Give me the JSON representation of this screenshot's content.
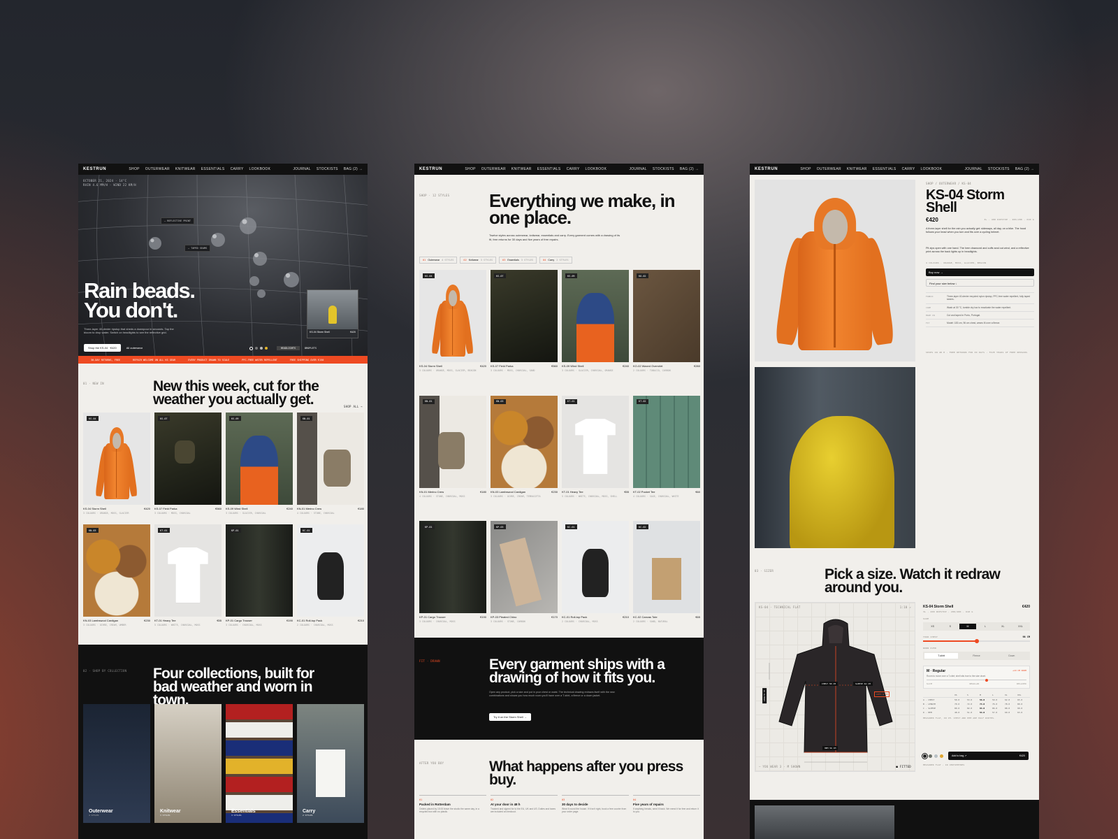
{
  "brand": "KESTRUN",
  "nav": {
    "links": [
      "SHOP",
      "OUTERWEAR",
      "KNITWEAR",
      "ESSENTIALS",
      "CARRY",
      "LOOKBOOK"
    ],
    "right": [
      "JOURNAL",
      "STOCKISTS",
      "BAG (2) →"
    ]
  },
  "home": {
    "meta": "OCTOBER 21, 2024 · 14°C\nRAIN 4.6 MM/H · WIND 22 KM/H",
    "hero_title_1": "Rain beads.",
    "hero_title_2": "You don't.",
    "hero_body": "Three-layer 40-denier ripstop that sheds a downpour in seconds. Tap the bloom to drop water. Switch on headlights to see the reflective grid.",
    "hero_cta": "Shop the KS-04 · €420",
    "hero_link": "All outerwear",
    "callout_1": "— REFLECTIVE PRINT",
    "callout_2": "— TAPED SEAMS",
    "mini_card_name": "KS-04 Storm Shell",
    "mini_card_price": "€420",
    "toggle_a": "HEADLIGHTS",
    "toggle_b": "DROPLETS",
    "ticker": [
      "30-DAY RETURNS, FREE",
      "REPAIR WELCOME ON ALL KS GEAR",
      "EVERY PRODUCT DRAWN TO SCALE",
      "PFC-FREE WATER REPELLENT",
      "FREE SHIPPING OVER €150"
    ],
    "new_kicker": "01 · NEW IN",
    "new_title": "New this week, cut for the weather you actually get.",
    "shop_all": "SHOP ALL →",
    "new_items": [
      {
        "tag": "KS-04",
        "name": "KS-04 Storm Shell",
        "price": "€420",
        "sub": "3 COLOURS · ORANGE, MOSS, GLACIER"
      },
      {
        "tag": "KS-07",
        "name": "KS-07 Field Parka",
        "price": "€560",
        "sub": "3 COLOURS · MOSS, CHARCOAL"
      },
      {
        "tag": "KS-09",
        "name": "KS-09 Wind Shell",
        "price": "€240",
        "sub": "3 COLOURS · GLACIER, CHARCOAL"
      },
      {
        "tag": "KN-01",
        "name": "KN-01 Merino Crew",
        "price": "€180",
        "sub": "4 COLOURS · STONE, CHARCOAL"
      },
      {
        "tag": "KN-03",
        "name": "KN-03 Lambswool Cardigan",
        "price": "€230",
        "sub": "3 COLOURS · OCHRE, CREAM, UMBER"
      },
      {
        "tag": "KT-01",
        "name": "KT-01 Heavy Tee",
        "price": "€55",
        "sub": "5 COLOURS · WHITE, CHARCOAL, MOSS"
      },
      {
        "tag": "KP-01",
        "name": "KP-01 Cargo Trouser",
        "price": "€190",
        "sub": "3 COLOURS · CHARCOAL, MOSS"
      },
      {
        "tag": "KC-01",
        "name": "KC-01 Roll-top Pack",
        "price": "€210",
        "sub": "2 COLOURS · CHARCOAL, MOSS"
      }
    ],
    "collections_kicker": "02 · SHOP BY COLLECTION",
    "collections_title": "Four collections, built for bad weather and worn in town.",
    "collections": [
      {
        "name": "Outerwear",
        "count": "4 STYLES"
      },
      {
        "name": "Knitwear",
        "count": "3 STYLES"
      },
      {
        "name": "Essentials",
        "count": "3 STYLES"
      },
      {
        "name": "Carry",
        "count": "2 STYLES"
      }
    ]
  },
  "shop": {
    "crumb": "SHOP · 12 STYLES",
    "title": "Everything we make, in one place.",
    "body": "Twelve styles across outerwear, knitwear, essentials and carry. Every garment comes with a drawing of its fit, free returns for 30 days and five years of free repairs.",
    "filters": [
      {
        "n": "01",
        "label": "Outerwear",
        "count": "4 STYLES"
      },
      {
        "n": "02",
        "label": "Knitwear",
        "count": "3 STYLES"
      },
      {
        "n": "03",
        "label": "Essentials",
        "count": "3 STYLES"
      },
      {
        "n": "04",
        "label": "Carry",
        "count": "2 STYLES"
      }
    ],
    "products": [
      {
        "tag": "KS-04",
        "name": "KS-04 Storm Shell",
        "price": "€420",
        "sub": "3 COLOURS · ORANGE, MOSS, GLACIER, BEACON"
      },
      {
        "tag": "KS-07",
        "name": "KS-07 Field Parka",
        "price": "€560",
        "sub": "3 COLOURS · MOSS, CHARCOAL, SAND"
      },
      {
        "tag": "KS-09",
        "name": "KS-09 Wind Shell",
        "price": "€240",
        "sub": "3 COLOURS · GLACIER, CHARCOAL, ORANGE"
      },
      {
        "tag": "KO-02",
        "name": "KO-02 Waxed Overshirt",
        "price": "€260",
        "sub": "2 COLOURS · TOBACCO, CARBON"
      },
      {
        "tag": "KN-01",
        "name": "KN-01 Merino Crew",
        "price": "€180",
        "sub": "4 COLOURS · STONE, CHARCOAL, MOSS"
      },
      {
        "tag": "KN-03",
        "name": "KN-03 Lambswool Cardigan",
        "price": "€230",
        "sub": "3 COLOURS · OCHRE, CREAM, TERRACOTTA"
      },
      {
        "tag": "KT-01",
        "name": "KT-01 Heavy Tee",
        "price": "€55",
        "sub": "5 COLOURS · WHITE, CHARCOAL, MOSS, SHELL"
      },
      {
        "tag": "KT-02",
        "name": "KT-02 Pocket Tee",
        "price": "€60",
        "sub": "4 COLOURS · SAGE, CHARCOAL, WHITE"
      },
      {
        "tag": "KP-01",
        "name": "KP-01 Cargo Trouser",
        "price": "€190",
        "sub": "3 COLOURS · CHARCOAL, MOSS"
      },
      {
        "tag": "KP-03",
        "name": "KP-03 Pleated Chino",
        "price": "€170",
        "sub": "3 COLOURS · STONE, CARBON"
      },
      {
        "tag": "KC-01",
        "name": "KC-01 Roll-top Pack",
        "price": "€210",
        "sub": "2 COLOURS · CHARCOAL, MOSS"
      },
      {
        "tag": "KC-02",
        "name": "KC-02 Canvas Tote",
        "price": "€65",
        "sub": "2 COLOURS · SAND, NATURAL"
      }
    ],
    "fit_kicker": "FIT · DRAWN",
    "fit_title": "Every garment ships with a drawing of how it fits you.",
    "fit_body": "Open any product, pick a size and put in your chest or waist. The technical drawing redraws itself with the new combinations and shows you how much room you'll have over a T-shirt, a fleece or a down jacket.",
    "fit_cta": "Try it on the Storm Shell →",
    "after_kicker": "AFTER YOU BUY",
    "after_title": "What happens after you press buy.",
    "steps": [
      {
        "n": "01",
        "title": "Packed in Rotterdam",
        "body": "Orders placed by 15:00 leave the studio the same day, in a recycled box with no plastic."
      },
      {
        "n": "02",
        "title": "At your door in 48 h",
        "body": "Tracked and signed for to the EU, UK and US. Duties and taxes are included at checkout."
      },
      {
        "n": "03",
        "title": "30 days to decide",
        "body": "Wear it round the house. If it isn't right, book a free courier from your order page."
      },
      {
        "n": "04",
        "title": "Five years of repairs",
        "body": "If anything breaks, send it back. We mend it for free and return it to you."
      }
    ]
  },
  "product": {
    "crumb": "SHOP / OUTERWEAR / KS-04",
    "title": "KS-04 Storm Shell",
    "price": "€420",
    "meta": "3L · 40D RIPSTOP · 20K/20K · 610 G",
    "body_1": "A three-layer shell for the rain you actually get: sideways, all day, on a bike. The hood follows your head when you turn and fits over a cycling helmet.",
    "body_2": "Pit zips open with one hand. The hem drawcord and cuffs seal out wind, and a reflective print across the back lights up in headlights.",
    "colours": "4 COLOURS · ORANGE, MOSS, GLACIER, BEACON",
    "buy": "Buy now →",
    "find_size": "Find your size below ↓",
    "specs": [
      {
        "k": "FABRIC",
        "v": "Three-layer 40-denier recycled nylon ripstop, PFC-free water repellent, fully taped seams."
      },
      {
        "k": "CARE",
        "v": "Wash at 30 °C, tumble dry low to reactivate the water repellent."
      },
      {
        "k": "MADE IN",
        "v": "Cut and taped in Porto, Portugal."
      },
      {
        "k": "FIT",
        "v": "Model: 183 cm, 96 cm chest, wears M over a fleece."
      }
    ],
    "shipping_note": "SHIPS IN 48 H · FREE RETURNS FOR 30 DAYS · FIVE YEARS OF FREE REPAIRS",
    "size_kicker": "03 · SIZER",
    "size_title": "Pick a size. Watch it redraw around you.",
    "drawing_label": "KS-04 · TECHNICAL FLAT",
    "drawing_scale": "1:10 ↗",
    "measure_chest": "CHEST 58 CM",
    "measure_sleeve": "SLEEVE 64 CM",
    "measure_hem": "HEM 56 CM",
    "measure_length": "LENGTH 78",
    "side_note": "LEFT 4 CM",
    "drawing_footer": "— YOU WEAR 3 · M SHOWN",
    "legend": "■ FITTED",
    "sizer_name": "KS-04 Storm Shell",
    "sizer_price": "€420",
    "sizer_meta": "3L · 40D RIPSTOP · 20K/20K · 610 G",
    "size_label": "SIZE",
    "sizes": [
      "XS",
      "S",
      "M",
      "L",
      "XL",
      "XXL"
    ],
    "selected_size": "M",
    "chest_label": "YOUR CHEST",
    "chest_value": "98 CM",
    "chest_fill": 0.5,
    "layer_label": "WORN OVER",
    "layers": [
      "T-shirt",
      "Fleece",
      "Down"
    ],
    "selected_layer": "T-shirt",
    "fit_name": "M · Regular",
    "fit_room": "+10 CM ROOM",
    "fit_desc": "Room to move over a T-shirt; shell sits true to the size chart.",
    "fit_scale": [
      "SLIM",
      "REGULAR",
      "RELAXED"
    ],
    "fit_fill": 0.6,
    "table_head": [
      "",
      "XS",
      "S",
      "M",
      "L",
      "XL",
      "XXL"
    ],
    "table_rows": [
      {
        "label": "A · CHEST",
        "values": [
          "50.0",
          "53.0",
          "56.0",
          "59.0",
          "62.0",
          "65.0"
        ]
      },
      {
        "label": "B · LENGTH",
        "values": [
          "70.0",
          "72.0",
          "74.0",
          "76.0",
          "78.0",
          "80.0"
        ]
      },
      {
        "label": "C · SLEEVE",
        "values": [
          "80.0",
          "82.0",
          "84.0",
          "86.0",
          "88.0",
          "90.0"
        ]
      },
      {
        "label": "D · HEM",
        "values": [
          "48.0",
          "51.0",
          "54.0",
          "57.0",
          "60.0",
          "63.0"
        ]
      }
    ],
    "table_note": "MEASURED FLAT, IN CM. CHEST AND HEM ARE HALF WIDTHS.",
    "swatch_colors": [
      "#222222",
      "#6a6f66",
      "#b8c0c4",
      "#e0a630"
    ],
    "add_to_bag": "Add to bag ↗",
    "add_price": "€420",
    "fine_print": "MEASURED FLAT · IN CENTIMETRES"
  },
  "colors": {
    "accent": "#ee4a22",
    "ink": "#111111",
    "paper": "#f1efeb"
  }
}
